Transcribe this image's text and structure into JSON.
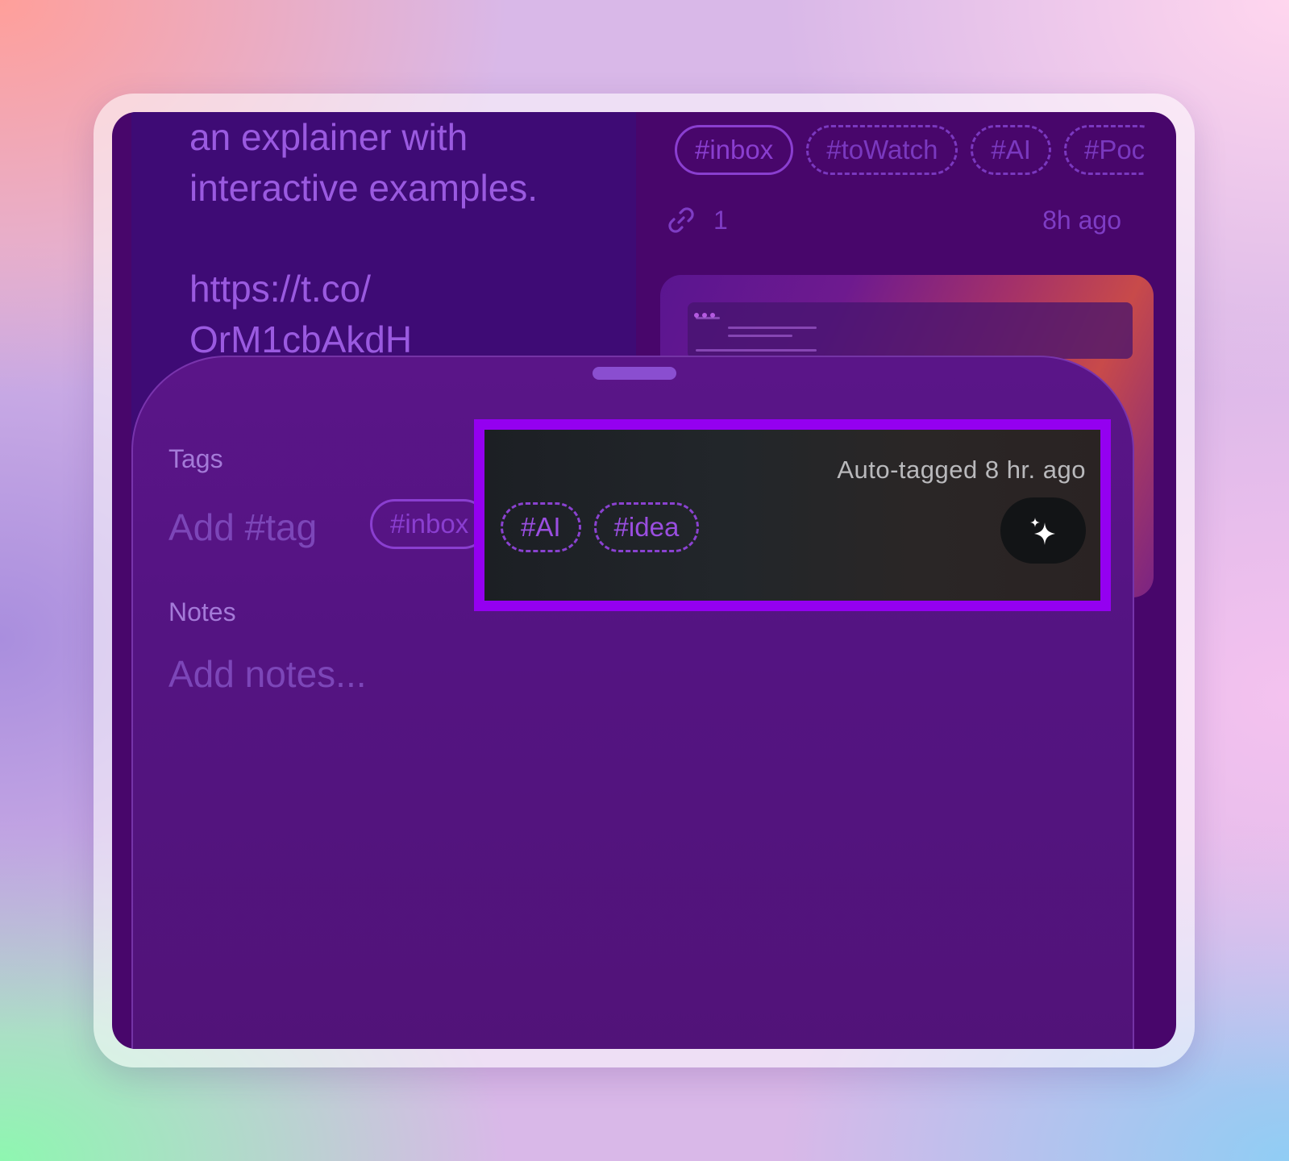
{
  "post": {
    "text_paragraphs": [
      "an explainer with\ninteractive examples.",
      "https://t.co/\nOrM1cbAkdH"
    ]
  },
  "card": {
    "tags": [
      {
        "label": "#inbox",
        "style": "solid"
      },
      {
        "label": "#toWatch",
        "style": "dashed"
      },
      {
        "label": "#AI",
        "style": "dashed"
      },
      {
        "label": "#Poc",
        "style": "dashed"
      }
    ],
    "link_count": "1",
    "time": "8h ago"
  },
  "sheet": {
    "tags_label": "Tags",
    "add_tag_placeholder": "Add #tag",
    "inbox_tag": "#inbox",
    "notes_label": "Notes",
    "notes_placeholder": "Add notes..."
  },
  "auto_tag": {
    "label": "Auto-tagged 8 hr. ago",
    "tags": [
      "#AI",
      "#idea"
    ],
    "action_icon": "sparkles-icon"
  },
  "colors": {
    "highlight_border": "#9400f0",
    "background": "#48066b",
    "accent": "#8a3ed0"
  }
}
